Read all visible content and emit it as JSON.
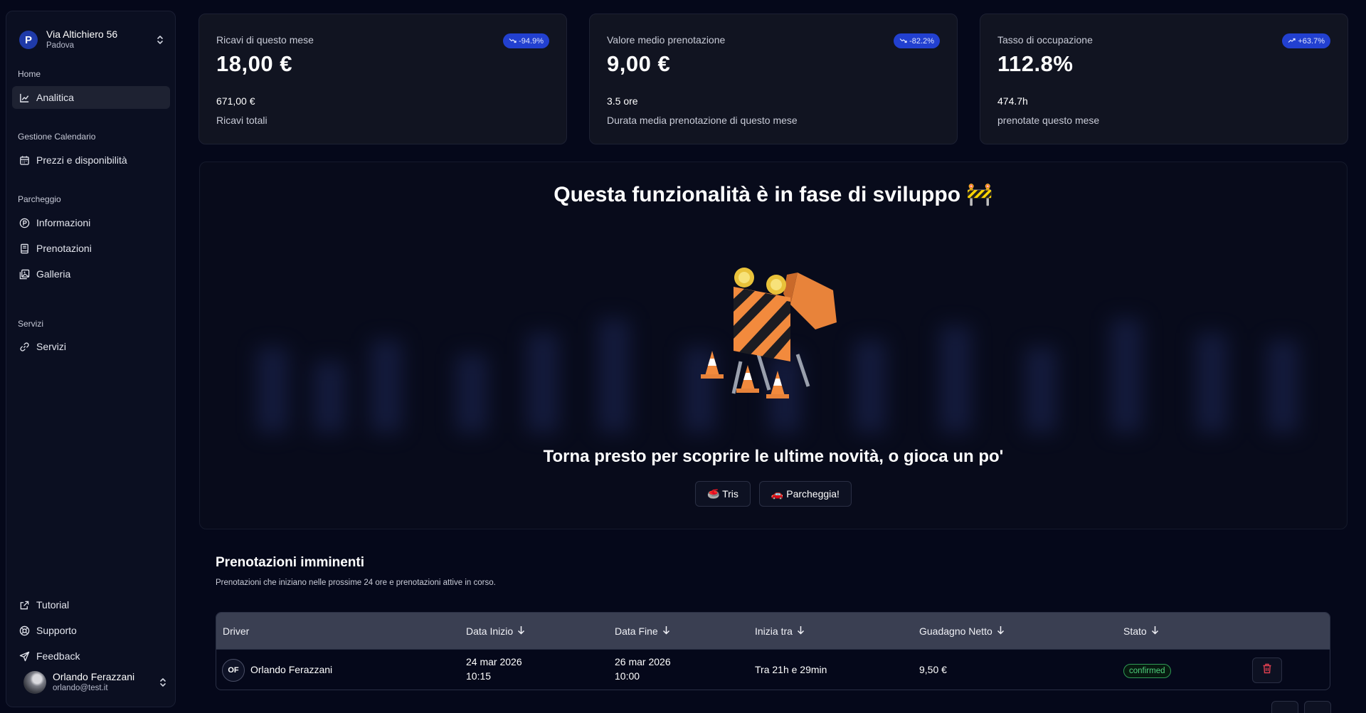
{
  "location": {
    "badge": "P",
    "name": "Via Altichiero 56",
    "city": "Padova"
  },
  "sidebar": {
    "groups": [
      {
        "label": "Home"
      },
      {
        "label": "Gestione Calendario"
      },
      {
        "label": "Parcheggio"
      },
      {
        "label": "Servizi"
      }
    ],
    "items": [
      {
        "label": "Analitica",
        "icon": "chart-line-icon"
      },
      {
        "label": "Prezzi e disponibilità",
        "icon": "calendar-icon"
      },
      {
        "label": "Informazioni",
        "icon": "parking-icon"
      },
      {
        "label": "Prenotazioni",
        "icon": "book-icon"
      },
      {
        "label": "Galleria",
        "icon": "gallery-icon"
      },
      {
        "label": "Servizi",
        "icon": "link-icon"
      },
      {
        "label": "Tutorial",
        "icon": "external-link-icon"
      },
      {
        "label": "Supporto",
        "icon": "lifebuoy-icon"
      },
      {
        "label": "Feedback",
        "icon": "send-icon"
      }
    ],
    "user": {
      "name": "Orlando Ferazzani",
      "email": "orlando@test.it"
    }
  },
  "cards": [
    {
      "label": "Ricavi di questo mese",
      "badge": "-94.9%",
      "value": "18,00 €",
      "sub_value": "671,00 €",
      "sub_label": "Ricavi totali",
      "trend": "down"
    },
    {
      "label": "Valore medio prenotazione",
      "badge": "-82.2%",
      "value": "9,00 €",
      "sub_value": "3.5 ore",
      "sub_label": "Durata media prenotazione di questo mese",
      "trend": "down"
    },
    {
      "label": "Tasso di occupazione",
      "badge": "+63.7%",
      "value": "112.8%",
      "sub_value": "474.7h",
      "sub_label": "prenotate questo mese",
      "trend": "up"
    }
  ],
  "dev": {
    "title": "Questa funzionalità è in fase di sviluppo 🚧",
    "subtitle": "Torna presto per scoprire le ultime novità, o gioca un po'",
    "buttons": [
      "🥌 Tris",
      "🚗 Parcheggia!"
    ]
  },
  "upcoming": {
    "title": "Prenotazioni imminenti",
    "description": "Prenotazioni che iniziano nelle prossime 24 ore e prenotazioni attive in corso.",
    "columns": [
      "Driver",
      "Data Inizio",
      "Data Fine",
      "Inizia tra",
      "Guadagno Netto",
      "Stato"
    ],
    "rows": [
      {
        "initials": "OF",
        "driver": "Orlando Ferazzani",
        "start_date": "24 mar 2026",
        "start_time": "10:15",
        "end_date": "26 mar 2026",
        "end_time": "10:00",
        "starts_in": "Tra 21h e 29min",
        "net": "9,50 €",
        "status": "confirmed"
      }
    ]
  },
  "colors": {
    "accent": "#2240d0",
    "status_ok": "#4fd27d",
    "danger": "#e04050"
  }
}
